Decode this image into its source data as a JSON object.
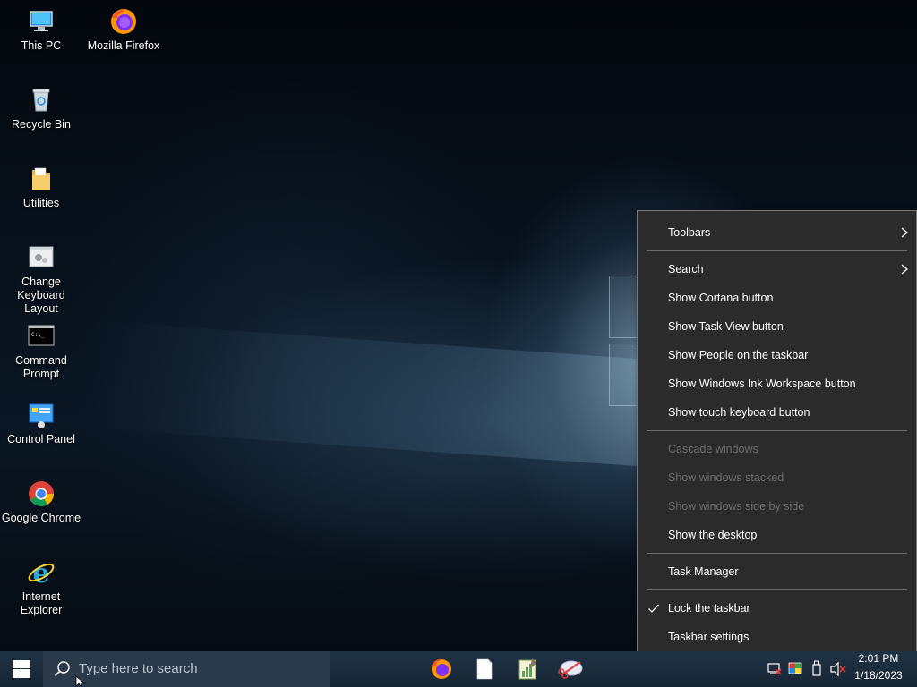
{
  "desktop_icons": [
    {
      "name": "This PC"
    },
    {
      "name": "Mozilla Firefox"
    },
    {
      "name": "Recycle Bin"
    },
    {
      "name": "Utilities"
    },
    {
      "name": "Change\nKeyboard Layout"
    },
    {
      "name": "Command\nPrompt"
    },
    {
      "name": "Control Panel"
    },
    {
      "name": "Google Chrome"
    },
    {
      "name": "Internet Explorer"
    }
  ],
  "taskbar": {
    "search_placeholder": "Type here to search",
    "pinned_apps": [
      "firefox-icon",
      "notepad-icon",
      "paint-chart-icon",
      "snipping-tool-icon"
    ],
    "tray_icons": [
      "network-disconnected-icon",
      "color-palette-icon",
      "usb-device-icon",
      "volume-muted-icon"
    ],
    "clock_time": "2:01 PM",
    "clock_date": "1/18/2023"
  },
  "context_menu": {
    "items": [
      {
        "label": "Toolbars",
        "submenu": true,
        "enabled": true
      },
      {
        "label": "Search",
        "submenu": true,
        "enabled": true
      },
      {
        "label": "Show Cortana button",
        "enabled": true
      },
      {
        "label": "Show Task View button",
        "enabled": true
      },
      {
        "label": "Show People on the taskbar",
        "enabled": true
      },
      {
        "label": "Show Windows Ink Workspace button",
        "enabled": true
      },
      {
        "label": "Show touch keyboard button",
        "enabled": true
      },
      {
        "label": "Cascade windows",
        "enabled": false
      },
      {
        "label": "Show windows stacked",
        "enabled": false
      },
      {
        "label": "Show windows side by side",
        "enabled": false
      },
      {
        "label": "Show the desktop",
        "enabled": true
      },
      {
        "label": "Task Manager",
        "enabled": true
      },
      {
        "label": "Lock the taskbar",
        "checked": true,
        "enabled": true
      },
      {
        "label": "Taskbar settings",
        "enabled": true
      }
    ]
  },
  "colors": {
    "menu_bg": "#2b2b2b",
    "menu_text": "#ffffff",
    "menu_disabled_text": "#6d6d6d",
    "taskbar_bg": "#1f3244"
  }
}
